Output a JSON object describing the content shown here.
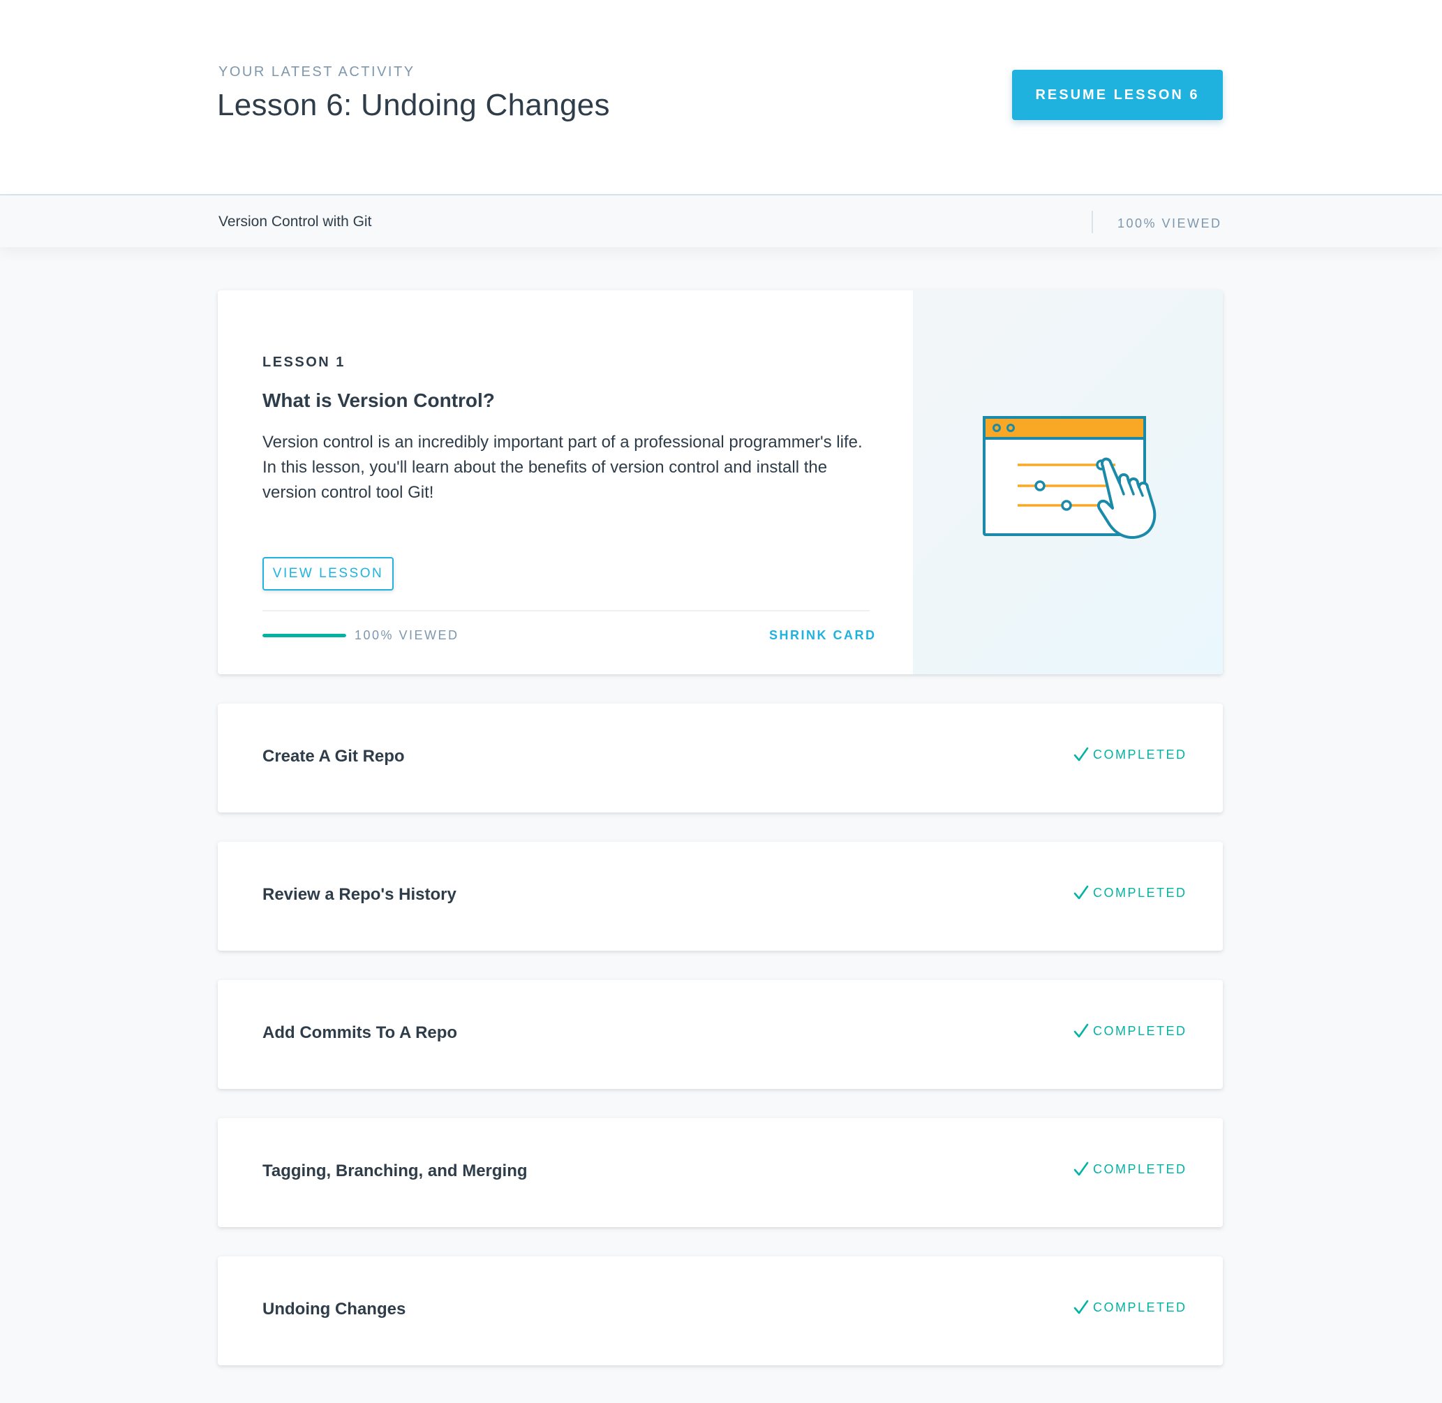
{
  "header": {
    "eyebrow": "YOUR LATEST ACTIVITY",
    "title": "Lesson 6: Undoing Changes",
    "resume_label": "RESUME LESSON 6"
  },
  "course": {
    "name": "Version Control with Git",
    "progress_text": "100% VIEWED"
  },
  "expanded_lesson": {
    "label": "LESSON 1",
    "title": "What is Version Control?",
    "description": "Version control is an incredibly important part of a professional programmer's life. In this lesson, you'll learn about the benefits of version control and install the version control tool Git!",
    "view_label": "VIEW LESSON",
    "progress_fraction": 1.0,
    "progress_text": "100% VIEWED",
    "shrink_label": "SHRINK CARD",
    "illustration_icon": "browser-window-hand-pointer-icon"
  },
  "lessons": [
    {
      "title": "Create A Git Repo",
      "status": "COMPLETED"
    },
    {
      "title": "Review a Repo's History",
      "status": "COMPLETED"
    },
    {
      "title": "Add Commits To A Repo",
      "status": "COMPLETED"
    },
    {
      "title": "Tagging, Branching, and Merging",
      "status": "COMPLETED"
    },
    {
      "title": "Undoing Changes",
      "status": "COMPLETED"
    }
  ],
  "colors": {
    "accent": "#1fb2df",
    "success": "#02b3a4",
    "progress": "#02b3a4",
    "text": "#2e3d49",
    "muted": "#7d97ad",
    "illustration_orange": "#f9a825",
    "illustration_teal": "#1b8aa8"
  }
}
